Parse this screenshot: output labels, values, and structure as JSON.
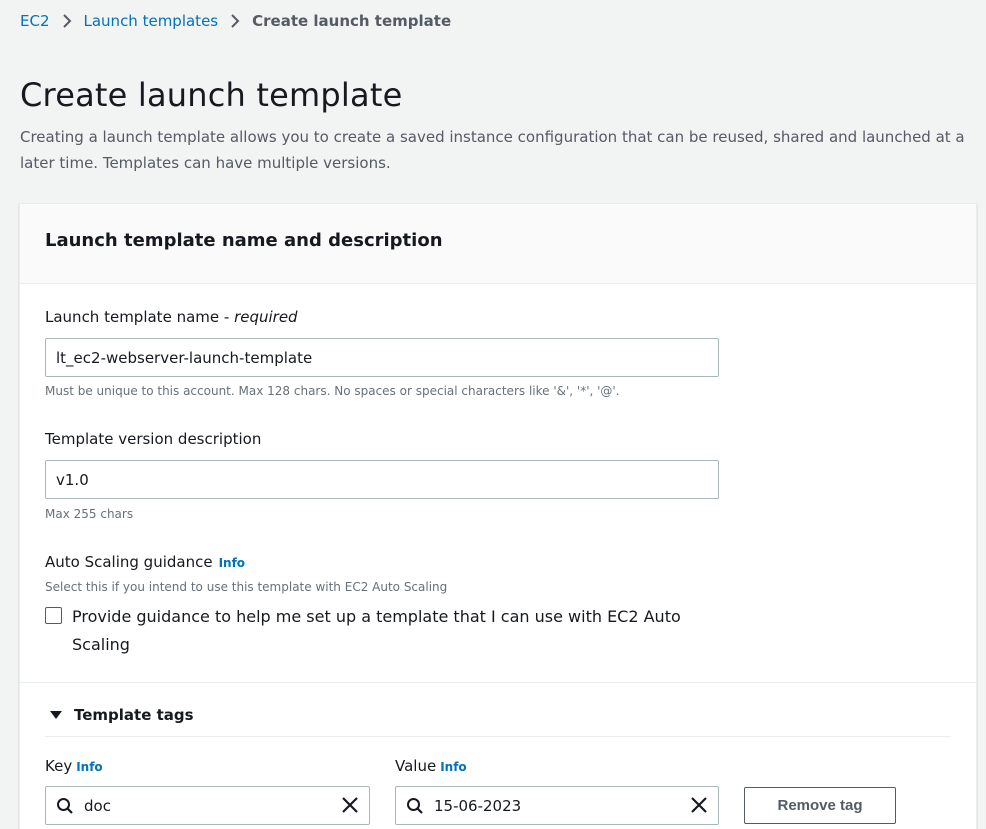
{
  "breadcrumb": {
    "items": [
      {
        "label": "EC2"
      },
      {
        "label": "Launch templates"
      },
      {
        "label": "Create launch template"
      }
    ]
  },
  "header": {
    "title": "Create launch template",
    "description": "Creating a launch template allows you to create a saved instance configuration that can be reused, shared and launched at a later time. Templates can have multiple versions."
  },
  "panel": {
    "title": "Launch template name and description",
    "name_field": {
      "label": "Launch template name - ",
      "label_required": "required",
      "value": "lt_ec2-webserver-launch-template",
      "hint": "Must be unique to this account. Max 128 chars. No spaces or special characters like '&', '*', '@'."
    },
    "version_field": {
      "label": "Template version description",
      "value": "v1.0",
      "hint": "Max 255 chars"
    },
    "autoscaling": {
      "label": "Auto Scaling guidance",
      "info": "Info",
      "description": "Select this if you intend to use this template with EC2 Auto Scaling",
      "checkbox_label": "Provide guidance to help me set up a template that I can use with EC2 Auto Scaling",
      "checked": false
    },
    "tags": {
      "title": "Template tags",
      "key_label": "Key",
      "value_label": "Value",
      "info": "Info",
      "key_value": "doc",
      "value_value": "15-06-2023",
      "remove_label": "Remove tag"
    }
  }
}
